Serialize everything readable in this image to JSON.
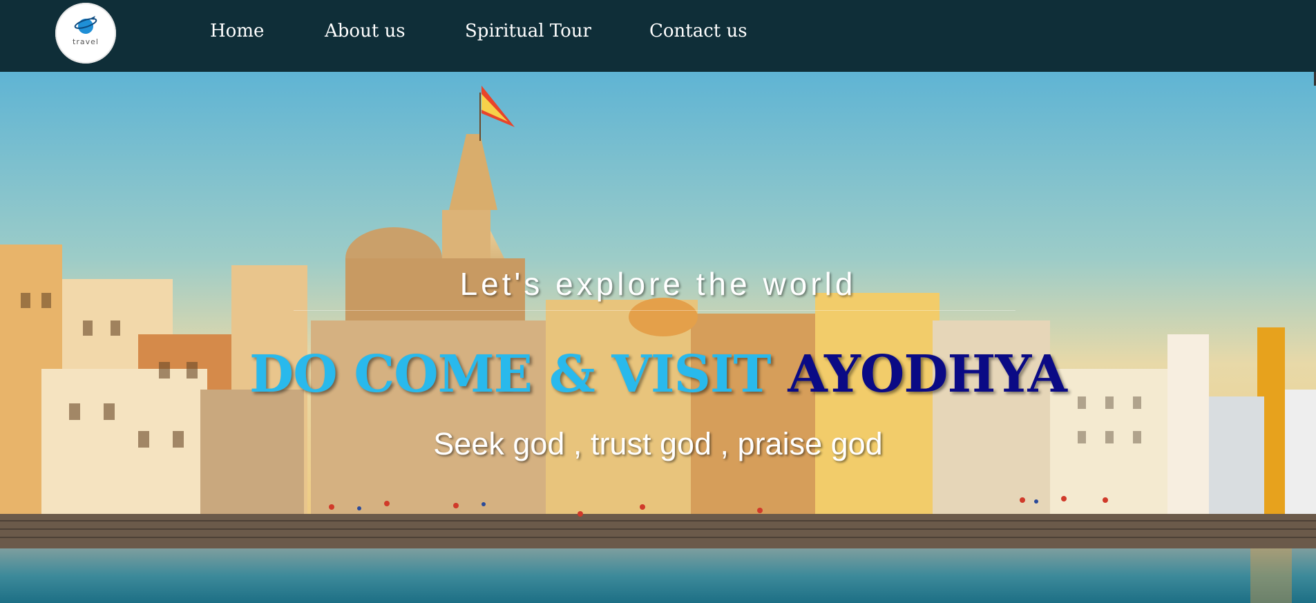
{
  "brand": {
    "logo_text": "travel"
  },
  "nav": {
    "items": [
      {
        "label": "Home"
      },
      {
        "label": "About us"
      },
      {
        "label": "Spiritual Tour"
      },
      {
        "label": "Contact us"
      }
    ]
  },
  "hero": {
    "tagline": "Let's explore the world",
    "headline_part1": "DO COME & VISIT",
    "headline_part2": "AYODHYA",
    "subline": "Seek god , trust god , praise god",
    "colors": {
      "headline_light": "#29b9ec",
      "headline_dark": "#0a0a85"
    }
  }
}
